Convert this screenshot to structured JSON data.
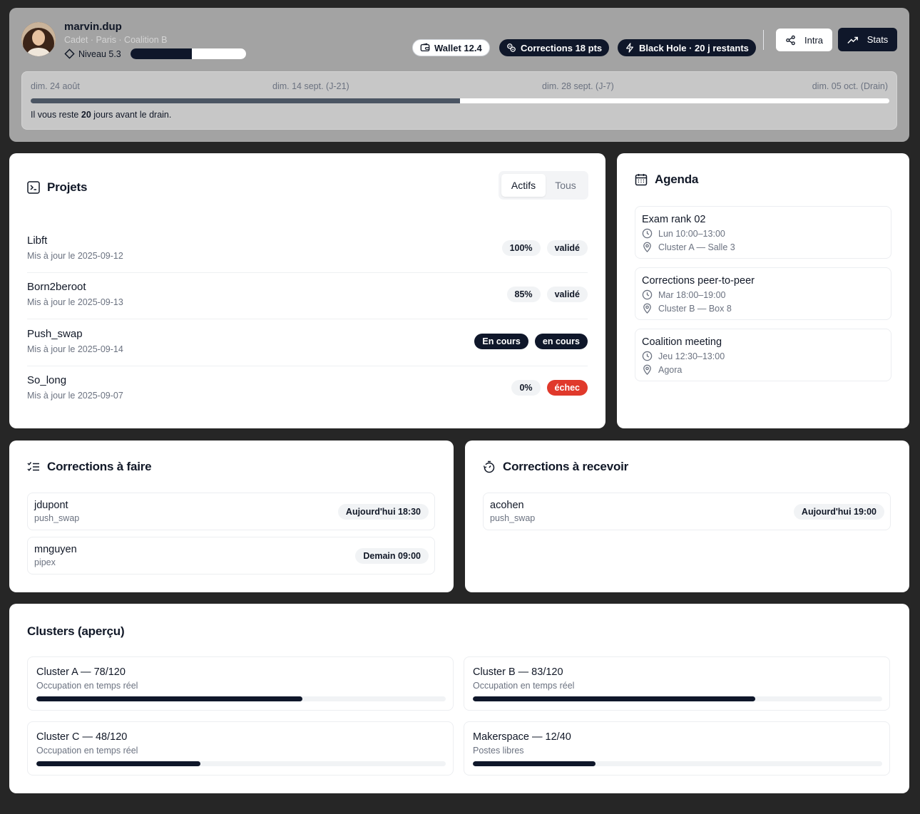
{
  "header": {
    "username": "marvin.dup",
    "meta": "Cadet · Paris · Coalition B",
    "level_label": "Niveau 5.3",
    "level_progress": 0.53,
    "wallet_label": "Wallet 12.4",
    "corrections_label": "Corrections 18 pts",
    "blackhole_label": "Black Hole · 20 j restants",
    "intra_label": "Intra",
    "stats_label": "Stats"
  },
  "timeline": {
    "date_start": "dim. 24 août",
    "date_j21": "dim. 14 sept. (J-21)",
    "date_j7": "dim. 28 sept. (J-7)",
    "date_drain": "dim. 05 oct. (Drain)",
    "progress": 0.5,
    "msg_before": "Il vous reste ",
    "days": "20",
    "msg_after": " jours avant le drain."
  },
  "projects": {
    "title": "Projets",
    "tab_active": "Actifs",
    "tab_all": "Tous",
    "items": [
      {
        "name": "Libft",
        "updated": "Mis à jour le 2025-09-12",
        "score": "100%",
        "status": "validé"
      },
      {
        "name": "Born2beroot",
        "updated": "Mis à jour le 2025-09-13",
        "score": "85%",
        "status": "validé"
      },
      {
        "name": "Push_swap",
        "updated": "Mis à jour le 2025-09-14",
        "score": "En cours",
        "status": "en cours"
      },
      {
        "name": "So_long",
        "updated": "Mis à jour le 2025-09-07",
        "score": "0%",
        "status": "échec"
      }
    ]
  },
  "agenda": {
    "title": "Agenda",
    "events": [
      {
        "title": "Exam rank 02",
        "time": "Lun 10:00–13:00",
        "place": "Cluster A — Salle 3"
      },
      {
        "title": "Corrections peer-to-peer",
        "time": "Mar 18:00–19:00",
        "place": "Cluster B — Box 8"
      },
      {
        "title": "Coalition meeting",
        "time": "Jeu 12:30–13:00",
        "place": "Agora"
      }
    ]
  },
  "corrections_todo": {
    "title": "Corrections à faire",
    "items": [
      {
        "login": "jdupont",
        "project": "push_swap",
        "when": "Aujourd'hui 18:30"
      },
      {
        "login": "mnguyen",
        "project": "pipex",
        "when": "Demain 09:00"
      }
    ]
  },
  "corrections_receive": {
    "title": "Corrections à recevoir",
    "items": [
      {
        "login": "acohen",
        "project": "push_swap",
        "when": "Aujourd'hui 19:00"
      }
    ]
  },
  "clusters": {
    "title": "Clusters (aperçu)",
    "items": [
      {
        "name": "Cluster A — 78/120",
        "sub": "Occupation en temps réel",
        "ratio": 0.65
      },
      {
        "name": "Cluster B — 83/120",
        "sub": "Occupation en temps réel",
        "ratio": 0.69
      },
      {
        "name": "Cluster C — 48/120",
        "sub": "Occupation en temps réel",
        "ratio": 0.4
      },
      {
        "name": "Makerspace — 12/40",
        "sub": "Postes libres",
        "ratio": 0.3
      }
    ]
  }
}
